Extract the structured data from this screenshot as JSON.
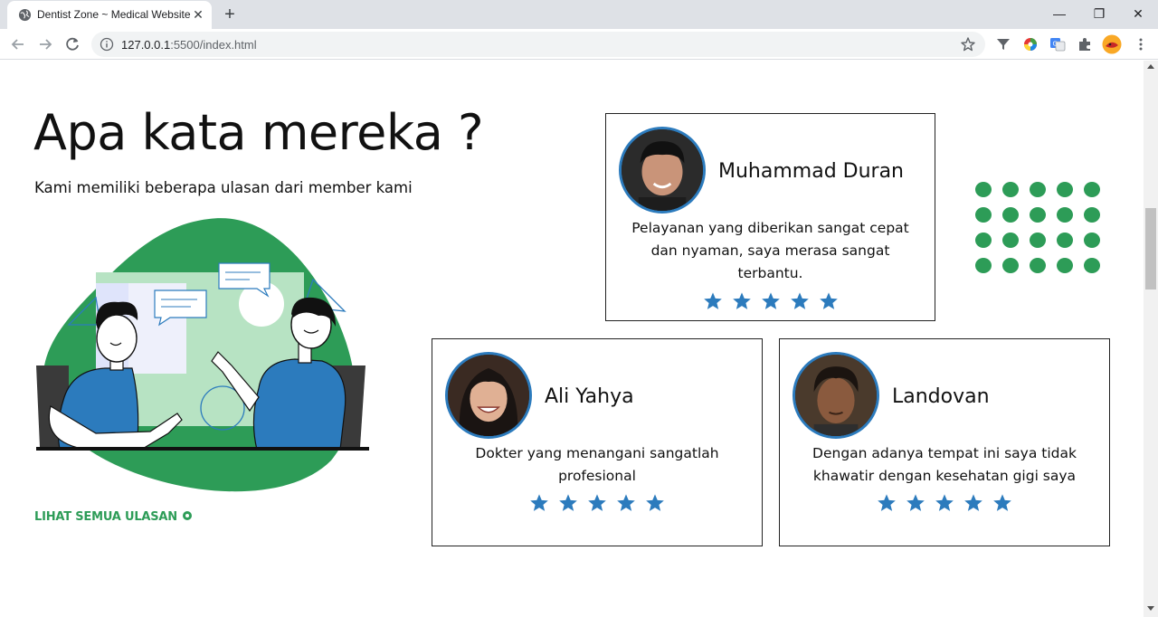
{
  "browser": {
    "tab_title": "Dentist Zone ~ Medical Website",
    "url_host": "127.0.0.1",
    "url_rest": ":5500/index.html",
    "new_tab": "+",
    "close_tab": "✕",
    "minimize": "—",
    "restore": "❐",
    "close_window": "✕"
  },
  "section": {
    "title": "Apa kata mereka ?",
    "subtitle": "Kami memiliki beberapa ulasan dari member kami",
    "see_all": "LIHAT SEMUA ULASAN"
  },
  "reviews": [
    {
      "name": "Muhammad Duran",
      "text": "Pelayanan yang diberikan sangat cepat dan nyaman, saya merasa sangat terbantu.",
      "rating": 5
    },
    {
      "name": "Ali Yahya",
      "text": "Dokter yang menangani sangatlah profesional",
      "rating": 5
    },
    {
      "name": "Landovan",
      "text": "Dengan adanya tempat ini saya tidak khawatir dengan kesehatan gigi saya",
      "rating": 5
    }
  ],
  "colors": {
    "accent_green": "#2d9c57",
    "accent_blue": "#2c7bbd",
    "star": "#2c7bbd"
  }
}
